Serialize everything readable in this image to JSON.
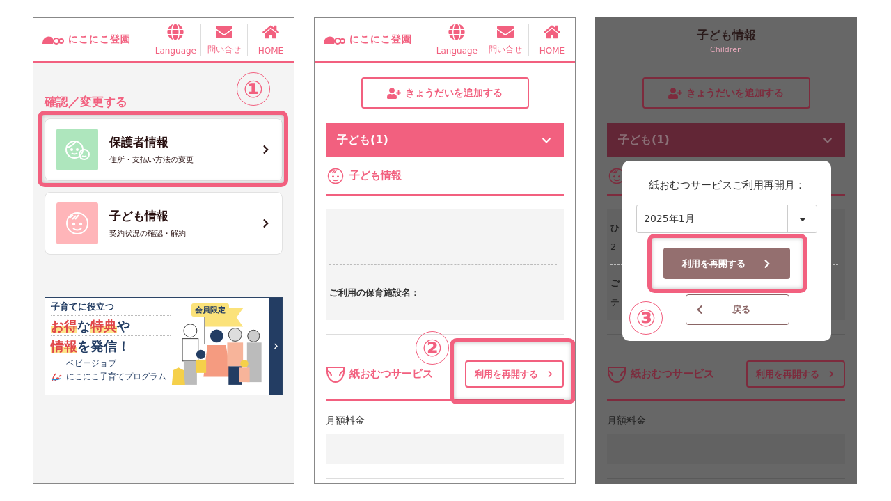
{
  "screen_1": {
    "dimmed": false,
    "header": {
      "logo": "にこにこ登園",
      "nav": [
        {
          "kind": "globe",
          "label": "Language"
        },
        {
          "kind": "mail",
          "label": "問い合せ"
        },
        {
          "kind": "home",
          "label": "HOME"
        }
      ]
    },
    "step": "①",
    "section_title": "確認／変更する",
    "cards": [
      {
        "kind": "parent",
        "title": "保護者情報",
        "subtitle": "住所・支払い方法の変更",
        "color": "#aee6bd",
        "highlighted": true
      },
      {
        "kind": "child",
        "title": "子ども情報",
        "subtitle": "契約状況の確認・解約",
        "color": "#ffb5b9",
        "highlighted": false
      }
    ],
    "banner": {
      "lead": "子育てに役立つ",
      "line_1": "**お得**な**特典**や",
      "line_2": "**情報**を発信！",
      "brand_small": "ベビージョブ",
      "brand": "にこにこ子育てプログラム",
      "flag": "会員限定"
    }
  },
  "screen_2": {
    "dimmed": false,
    "header": {
      "logo": "にこにこ登園",
      "nav": [
        {
          "kind": "globe",
          "label": "Language"
        },
        {
          "kind": "mail",
          "label": "問い合せ"
        },
        {
          "kind": "home",
          "label": "HOME"
        }
      ]
    },
    "add_button": "きょうだいを追加する",
    "accordion": {
      "label": "子ども(1)",
      "expanded": true
    },
    "section_title": "子ども情報",
    "info_rows": [
      {
        "text": ""
      },
      {
        "text": "ご利用の保育施設名："
      }
    ],
    "service": {
      "title": "紙おむつサービス",
      "button": "利用を再開する",
      "highlighted": true,
      "step": "②"
    },
    "fee_label": "月額料金"
  },
  "screen_3": {
    "dimmed": true,
    "page_title": "子ども情報",
    "page_subtitle": "Children",
    "add_button": "きょうだいを追加する",
    "accordion": {
      "label": "子ども(1)",
      "expanded": true
    },
    "info_rows": [
      {
        "text": "ひ",
        "sub": "2"
      },
      {
        "text": "ご",
        "sub": "テ"
      }
    ],
    "service": {
      "title": "紙おむつサービス",
      "button": "利用を再開する",
      "highlighted": false
    },
    "fee_label": "月額料金",
    "modal": {
      "label": "紙おむつサービスご利用再開月：",
      "select_value": "2025年1月",
      "confirm_button": "利用を再開する",
      "confirm_highlighted": true,
      "back_button": "戻る",
      "step": "③"
    }
  }
}
